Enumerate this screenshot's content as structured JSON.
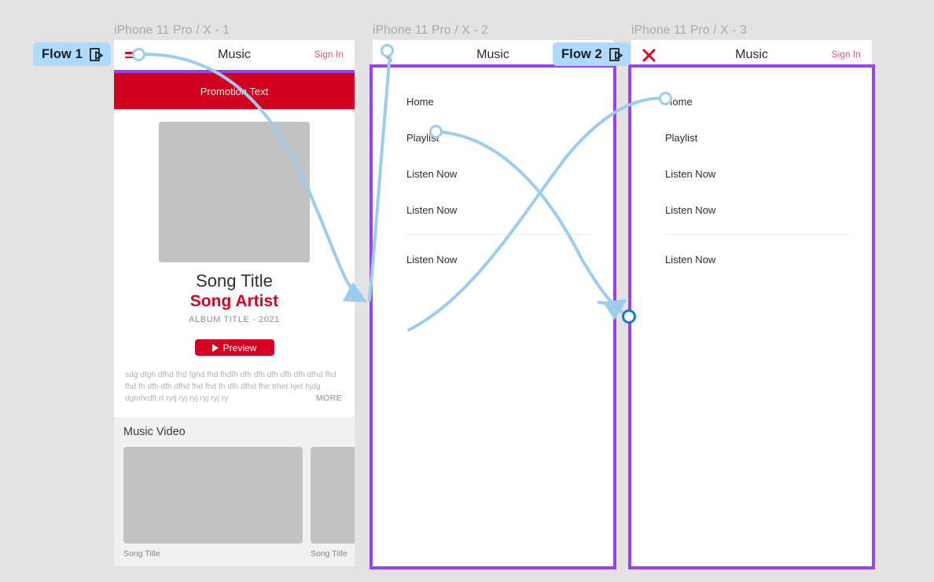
{
  "canvas": {
    "background_color": "#e3e3e3",
    "frame_border_color": "#9b41f0",
    "connector_color": "#9ccdee",
    "active_connector_color": "#0b7fcc",
    "accent_red": "#d20025",
    "flow_badge_color": "#addbff"
  },
  "frames": [
    {
      "label": "iPhone 11 Pro / X - 1",
      "flow_badge": {
        "label": "Flow 1",
        "icon": "flow-start-play-icon"
      },
      "navbar": {
        "left_icon": "hamburger-menu-icon",
        "title": "Music",
        "right_link": "Sign In"
      },
      "promotion": {
        "text": "Promotion Text"
      },
      "album": {
        "art": "album-art-placeholder",
        "song_title": "Song Title",
        "song_artist": "Song Artist",
        "meta": "ALBUM TITLE - 2021",
        "preview_button": "Preview"
      },
      "description": {
        "text": "sdg dfgh dfhd fhd fghd fhd fhdfh dfh dfh dfh dfh dfh dfhd fhd fhd fh dfh dfh dfhd fhd fhd fh dfh dfhd fhe trhet hjet hjdg dgtnhrdft rt rytj ryj ryj ryj ryj ry",
        "more_label": "MORE"
      },
      "music_video": {
        "section_title": "Music Video",
        "items": [
          {
            "caption": "Song Title"
          },
          {
            "caption": "Song Title"
          }
        ]
      }
    },
    {
      "label": "iPhone 11 Pro / X - 2",
      "flow_badge": {
        "label": "Flow 2",
        "icon": "flow-start-play-icon"
      },
      "navbar": {
        "left_icon": "back-chevron-icon",
        "title": "Music",
        "right_link": ""
      },
      "menu_items": [
        "Home",
        "Playlist",
        "Listen Now",
        "Listen Now",
        "Listen Now"
      ],
      "separator_after_index": 3
    },
    {
      "label": "iPhone 11 Pro / X - 3",
      "navbar": {
        "left_icon": "close-x-icon",
        "title": "Music",
        "right_link": "Sign In"
      },
      "menu_items": [
        "Home",
        "Playlist",
        "Listen Now",
        "Listen Now",
        "Listen Now"
      ],
      "separator_after_index": 3
    }
  ]
}
